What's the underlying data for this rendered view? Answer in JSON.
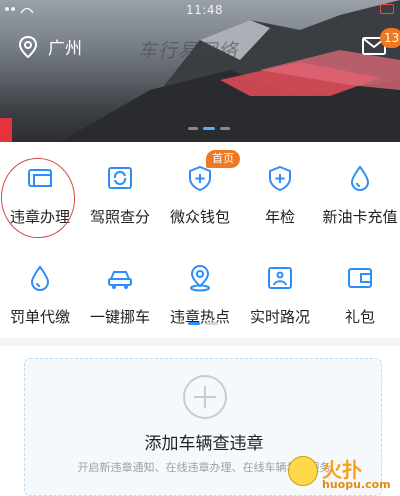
{
  "status_bar": {
    "time": "11:48"
  },
  "header": {
    "city": "广州",
    "banner_text": "车行易网络",
    "unread_count": "13"
  },
  "services": [
    {
      "label": "违章办理",
      "icon": "car-icon"
    },
    {
      "label": "驾照查分",
      "icon": "license-refresh-icon"
    },
    {
      "label": "微众钱包",
      "icon": "shield-plus-icon",
      "tag": "首页"
    },
    {
      "label": "年检",
      "icon": "shield-plus-icon"
    },
    {
      "label": "新油卡充值",
      "icon": "drop-icon"
    },
    {
      "label": "罚单代缴",
      "icon": "drop-icon"
    },
    {
      "label": "一键挪车",
      "icon": "car-icon"
    },
    {
      "label": "违章热点",
      "icon": "location-icon"
    },
    {
      "label": "实时路况",
      "icon": "map-icon"
    },
    {
      "label": "礼包",
      "icon": "gift-card-icon"
    }
  ],
  "add_vehicle": {
    "title": "添加车辆查违章",
    "subtitle": "开启新违章通知、在线违章办理、在线车辆年审服务"
  },
  "watermark": {
    "brand": "火扑",
    "url": "huopu.com"
  },
  "colors": {
    "accent": "#2f8ef5",
    "badge": "#f07820",
    "annotation": "#d8463f"
  }
}
